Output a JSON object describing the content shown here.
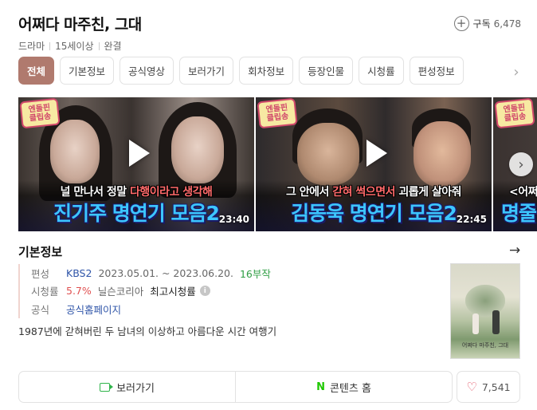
{
  "header": {
    "title": "어쩌다 마주친, 그대",
    "meta": [
      "드라마",
      "15세이상",
      "완결"
    ],
    "subscribe_label": "구독",
    "subscribe_count": "6,478"
  },
  "tabs": [
    "전체",
    "기본정보",
    "공식영상",
    "보러가기",
    "회차정보",
    "등장인물",
    "시청률",
    "편성정보"
  ],
  "videos": [
    {
      "badge_line1": "엔돌핀",
      "badge_line2": "클립송",
      "caption_pre": "널 만나서 정말 ",
      "caption_hl": "다행이라고 생각해",
      "caption_post": "",
      "headline": "진기주 명연기 모음2",
      "duration": "23:40"
    },
    {
      "badge_line1": "엔돌핀",
      "badge_line2": "클립송",
      "caption_pre": "그 안에서 ",
      "caption_hl": "갇혀 썩으면서",
      "caption_post": " 괴롭게 살아줘",
      "headline": "김동욱 명연기 모음2",
      "duration": "22:45"
    },
    {
      "badge_line1": "엔돌핀",
      "badge_line2": "클립송",
      "caption_pre": "<어쩌",
      "caption_hl": "",
      "caption_post": "",
      "headline": "명줄",
      "duration": ""
    }
  ],
  "info": {
    "section_title": "기본정보",
    "broadcast_label": "편성",
    "broadcast_channel": "KBS2",
    "broadcast_period": "2023.05.01. ~ 2023.06.20.",
    "broadcast_episodes": "16부작",
    "rating_label": "시청률",
    "rating_value": "5.7%",
    "rating_source": "닐슨코리아",
    "rating_peak": "최고시청률",
    "official_label": "공식",
    "official_link": "공식홈페이지",
    "description": "1987년에 갇혀버린 두 남녀의 이상하고 아름다운 시간 여행기"
  },
  "poster": {
    "title": "어쩌다 마주친, 그대"
  },
  "actions": {
    "watch_label": "보러가기",
    "content_label": "콘텐츠 홈",
    "content_icon": "N",
    "like_count": "7,541"
  },
  "colors": {
    "active_tab": "#b07a6e",
    "rating": "#e05050",
    "episodes": "#2f9e44",
    "link": "#2e54a8",
    "naver_green": "#1ec800"
  }
}
